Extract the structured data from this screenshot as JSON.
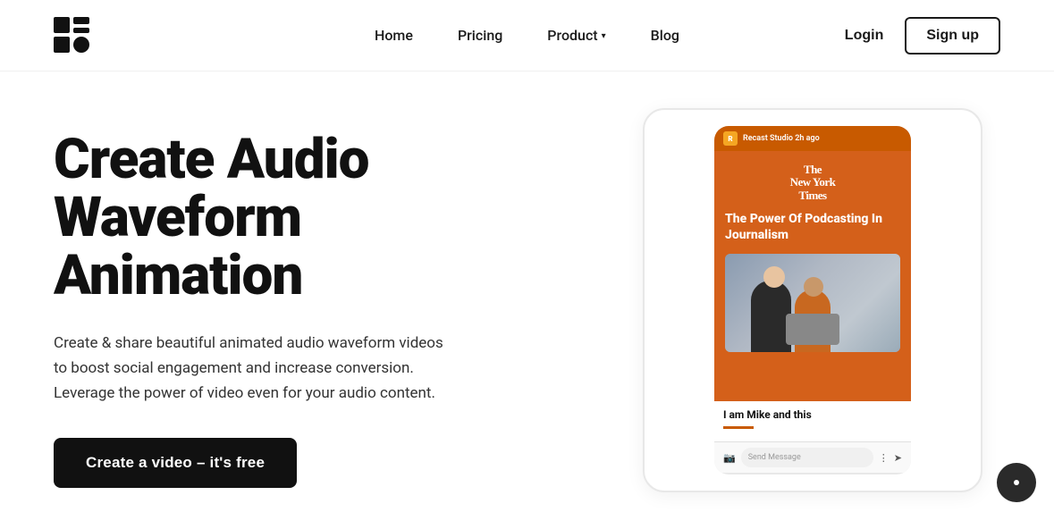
{
  "brand": {
    "name": "Recast Studio"
  },
  "nav": {
    "home": "Home",
    "pricing": "Pricing",
    "product": "Product",
    "blog": "Blog"
  },
  "header": {
    "login_label": "Login",
    "signup_label": "Sign up"
  },
  "hero": {
    "title_line1": "Create Audio",
    "title_line2": "Waveform",
    "title_line3": "Animation",
    "description": "Create & share beautiful animated audio waveform videos to boost social engagement and increase conversion. Leverage the power of video even for your audio content.",
    "cta": "Create a video – it's free"
  },
  "phone_preview": {
    "notification": "Recast Studio 2h ago",
    "nyt_name": "The New York Times",
    "podcast_title": "The Power Of Podcasting In Journalism",
    "caption": "I am Mike and this",
    "message_placeholder": "Send Message"
  }
}
